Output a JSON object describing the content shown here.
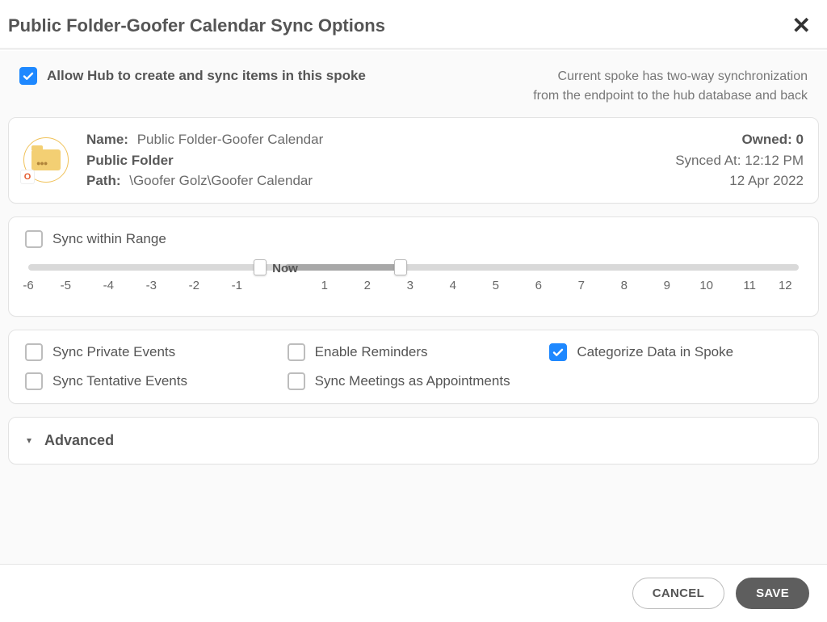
{
  "header": {
    "title": "Public Folder-Goofer Calendar Sync Options"
  },
  "allow": {
    "checked": true,
    "label": "Allow Hub to create and sync items in this spoke",
    "blurb_line1": "Current spoke has two-way synchronization",
    "blurb_line2": "from the endpoint to the hub database and back"
  },
  "info": {
    "name_label": "Name:",
    "name_value": "Public Folder-Goofer Calendar",
    "folder_type": "Public Folder",
    "path_label": "Path:",
    "path_value": "\\Goofer Golz\\Goofer Calendar",
    "owned_label": "Owned:",
    "owned_value": "0",
    "synced_label": "Synced At:",
    "synced_time": "12:12 PM",
    "synced_date": "12 Apr 2022",
    "badge_letter": "O"
  },
  "range": {
    "checked": false,
    "label": "Sync within Range",
    "now_label": "Now",
    "ticks": [
      "-6",
      "-5",
      "-4",
      "-3",
      "-2",
      "-1",
      "",
      "1",
      "2",
      "3",
      "4",
      "5",
      "6",
      "7",
      "8",
      "9",
      "10",
      "11",
      "12"
    ],
    "now_index": 6,
    "handle_left_index": 5.42,
    "handle_right_index": 8.7,
    "tick_count": 19
  },
  "options": {
    "sync_private": {
      "label": "Sync Private Events",
      "checked": false
    },
    "enable_reminders": {
      "label": "Enable Reminders",
      "checked": false
    },
    "categorize": {
      "label": "Categorize Data in Spoke",
      "checked": true
    },
    "sync_tentative": {
      "label": "Sync Tentative Events",
      "checked": false
    },
    "meetings_as_appts": {
      "label": "Sync Meetings as Appointments",
      "checked": false
    }
  },
  "advanced": {
    "label": "Advanced"
  },
  "footer": {
    "cancel": "CANCEL",
    "save": "SAVE"
  }
}
